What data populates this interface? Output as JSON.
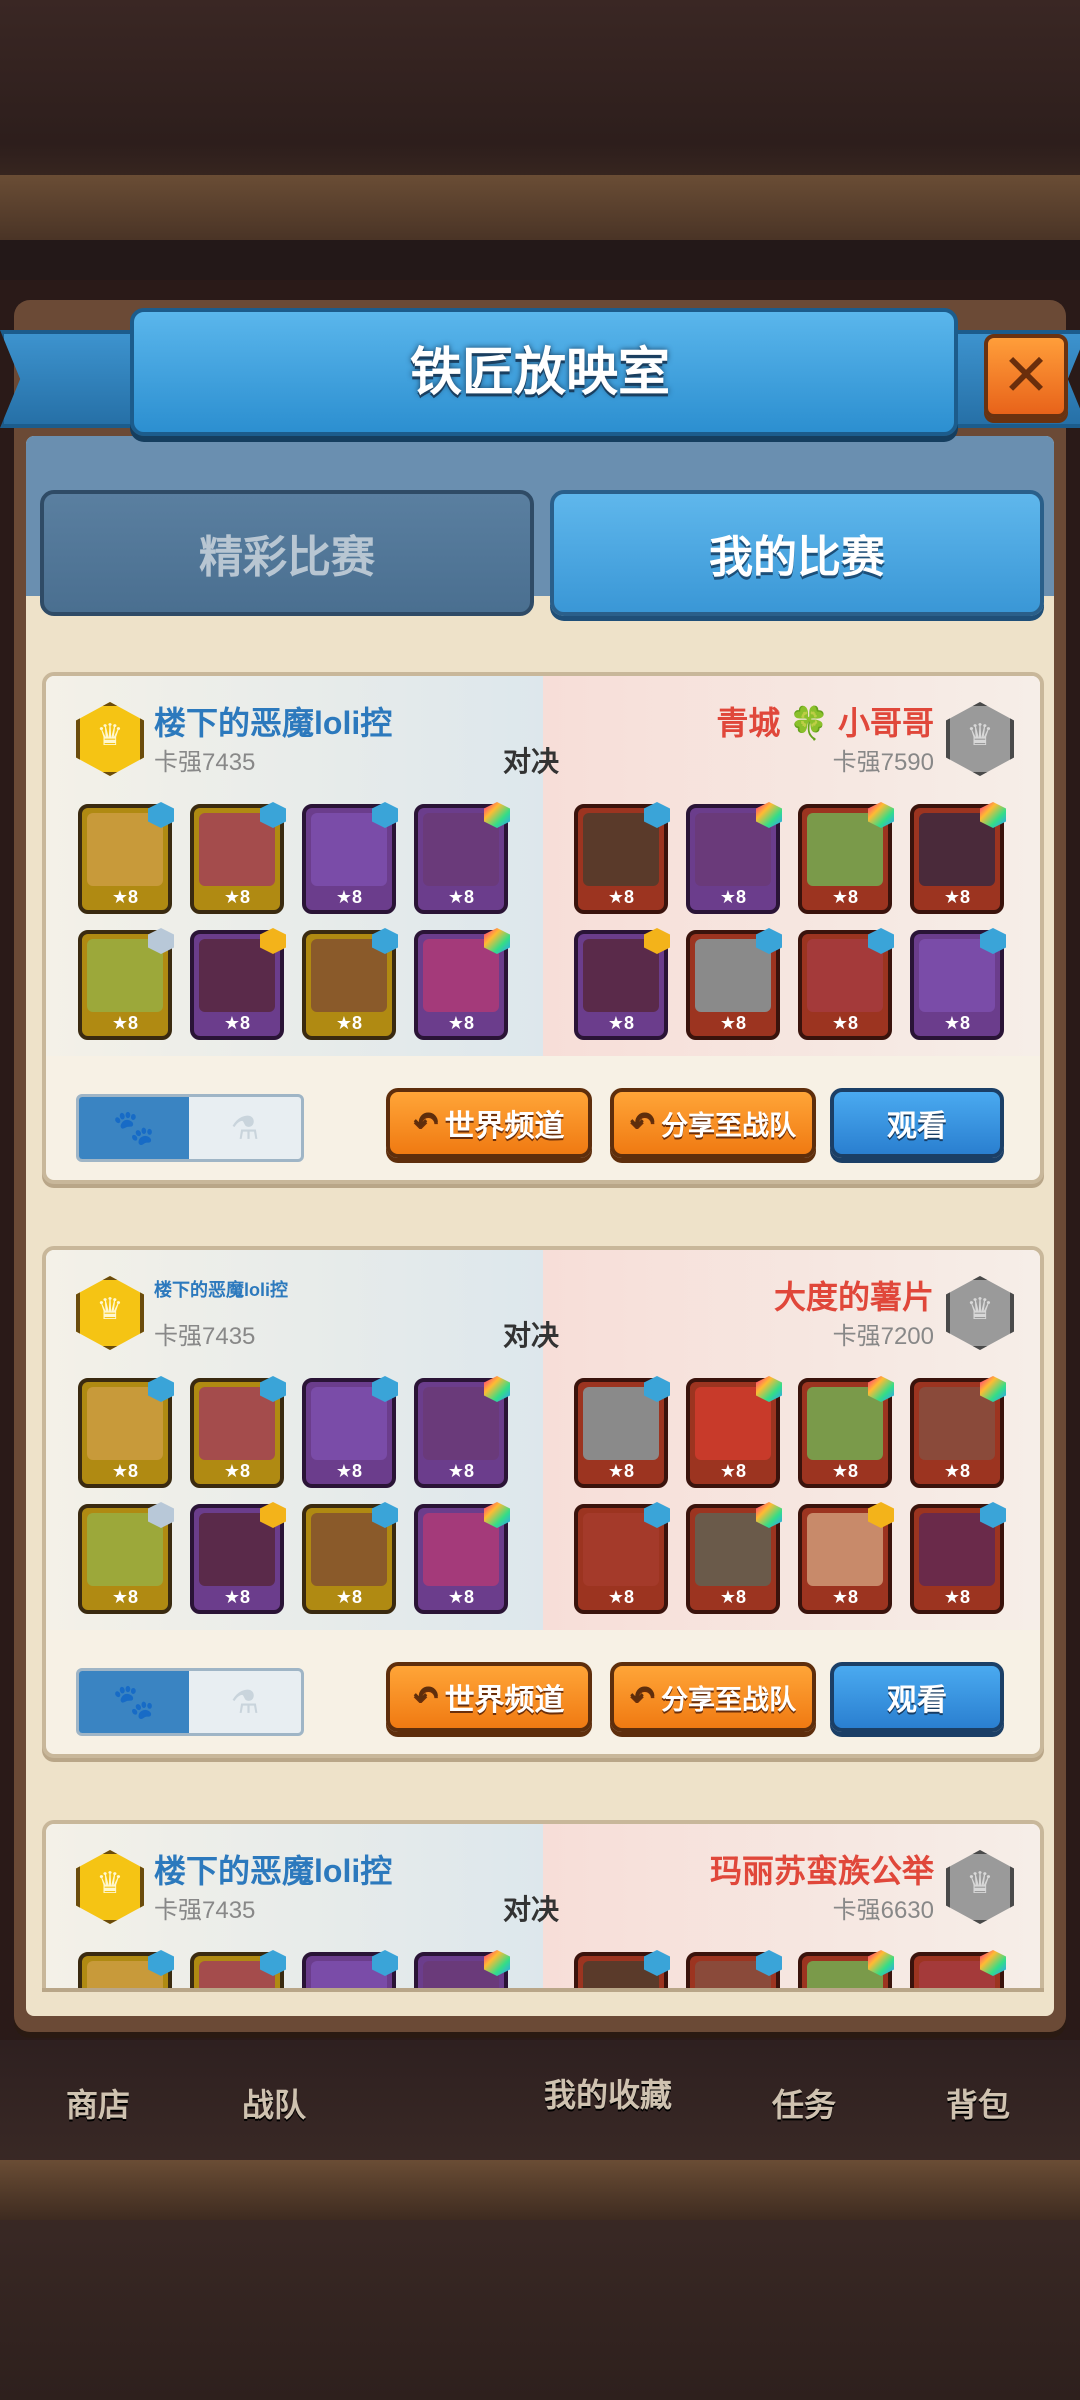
{
  "dialog": {
    "title": "铁匠放映室",
    "close_icon": "close-icon"
  },
  "tabs": [
    {
      "label": "精彩比赛",
      "active": false
    },
    {
      "label": "我的比赛",
      "active": true
    }
  ],
  "matches": [
    {
      "left": {
        "name": "楼下的恶魔loli控",
        "power": "卡强7435"
      },
      "vs": "对决",
      "right": {
        "name": "青城 🍀 小哥哥",
        "power": "卡强7590"
      },
      "star": "★8",
      "buttons": {
        "world": "世界频道",
        "share": "分享至战队",
        "watch": "观看"
      }
    },
    {
      "left": {
        "name": "楼下的恶魔loli控",
        "power": "卡强7435"
      },
      "vs": "对决",
      "right": {
        "name": "大度的薯片",
        "power": "卡强7200"
      },
      "star": "★8",
      "buttons": {
        "world": "世界频道",
        "share": "分享至战队",
        "watch": "观看"
      }
    },
    {
      "left": {
        "name": "楼下的恶魔loli控",
        "power": "卡强7435"
      },
      "vs": "对决",
      "right": {
        "name": "玛丽苏蛮族公举",
        "power": "卡强6630"
      },
      "star": "★8"
    }
  ],
  "bottom_nav": [
    "商店",
    "战队",
    "我的收藏",
    "任务",
    "背包"
  ],
  "colors": {
    "accent_blue": "#3a97d6",
    "orange_button": "#f07a12",
    "left_name": "#2c79bd",
    "right_name": "#e0473a"
  }
}
